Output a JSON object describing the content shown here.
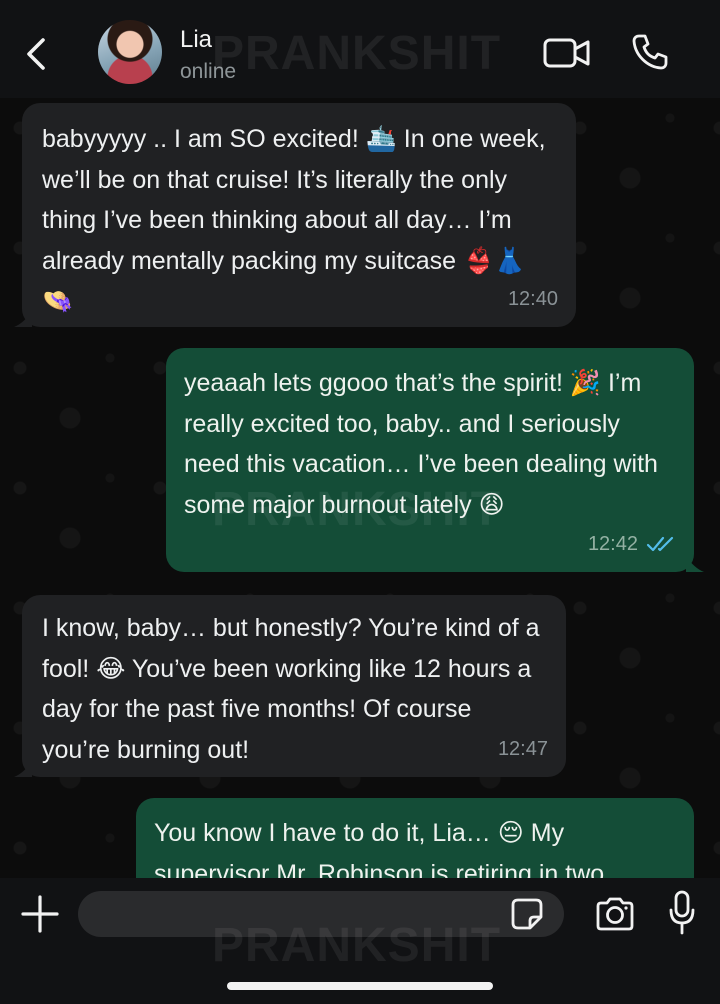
{
  "header": {
    "contact_name": "Lia",
    "status": "online",
    "watermark": "PRANKSHIT"
  },
  "messages": [
    {
      "direction": "incoming",
      "text": "babyyyyy .. I am SO excited! 🛳️ In one week, we’ll be on that cruise! It’s literally the only thing I’ve been thinking about all day… I’m already mentally packing my suitcase 👙👗👒",
      "time": "12:40"
    },
    {
      "direction": "outgoing",
      "text": "yeaaah lets ggooo that’s the spirit! 🎉 I’m really excited too, baby.. and I seriously need this vacation… I’ve been dealing with some major burnout lately 😩",
      "time": "12:42",
      "status_icon": "double-check-read"
    },
    {
      "direction": "incoming",
      "text": "I know, baby… but honestly? You’re kind of a fool! 😂 You’ve been working like 12 hours a day for the past five months! Of course you’re burning out!",
      "time": "12:47"
    },
    {
      "direction": "outgoing",
      "text": "You know I have to do it, Lia… 😔 My supervisor Mr. Robinson is retiring in two",
      "time": ""
    }
  ],
  "footer": {
    "input_placeholder": "",
    "watermark": "PRANKSHIT"
  },
  "colors": {
    "incoming_bubble": "#202123",
    "outgoing_bubble": "#144d37",
    "read_check": "#53bdeb",
    "header_bg": "#111214"
  },
  "icons": [
    "back-arrow-icon",
    "video-call-icon",
    "phone-icon",
    "plus-icon",
    "sticker-icon",
    "camera-icon",
    "microphone-icon"
  ]
}
